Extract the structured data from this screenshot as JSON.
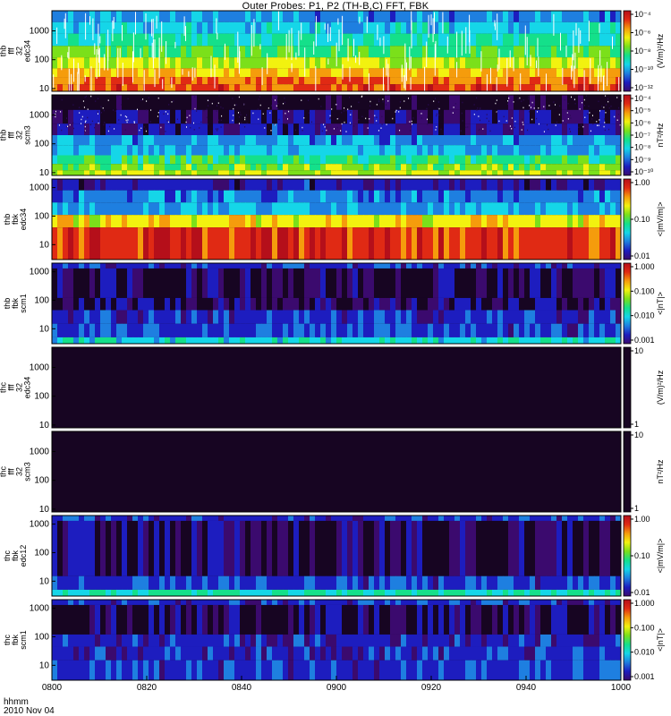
{
  "title": "Outer Probes: P1, P2 (TH-B,C) FFT, FBK",
  "footer": {
    "hhmm": "hhmm",
    "date": "2010 Nov 04"
  },
  "colors": {
    "colorbar": [
      "#3b0a6e",
      "#1d1dbf",
      "#1e7fe0",
      "#15d6e8",
      "#14e08a",
      "#7be01a",
      "#f2f20f",
      "#f59c0c",
      "#e02a14",
      "#b50f1a"
    ],
    "background_dark": "#170522"
  },
  "chart_data": [
    {
      "type": "heatmap",
      "probe": "thb",
      "kind": "fff",
      "channel": "32",
      "quantity": "edc34",
      "ylabel": [
        "thb",
        "fff",
        "32",
        "edc34"
      ],
      "yscale": "log",
      "ylim": [
        8,
        5000
      ],
      "yticks": [
        "1000",
        "100",
        "10"
      ],
      "cbar_units": "(V/m)²/Hz",
      "cbar_ticks": [
        "10⁻⁴",
        "10⁻⁶",
        "10⁻⁸",
        "10⁻¹⁰",
        "10⁻¹²"
      ],
      "bands": [
        {
          "lo": 5000,
          "hi": 2000,
          "level": 0.24
        },
        {
          "lo": 2000,
          "hi": 800,
          "level": 0.32
        },
        {
          "lo": 800,
          "hi": 300,
          "level": 0.4
        },
        {
          "lo": 300,
          "hi": 120,
          "level": 0.5
        },
        {
          "lo": 120,
          "hi": 50,
          "level": 0.62
        },
        {
          "lo": 50,
          "hi": 25,
          "level": 0.74
        },
        {
          "lo": 25,
          "hi": 14,
          "level": 0.82
        },
        {
          "lo": 14,
          "hi": 8,
          "level": 0.88
        }
      ]
    },
    {
      "type": "heatmap",
      "probe": "thb",
      "kind": "fff",
      "channel": "32",
      "quantity": "scm3",
      "ylabel": [
        "thb",
        "fff",
        "32",
        "scm3"
      ],
      "yscale": "log",
      "ylim": [
        8,
        5000
      ],
      "yticks": [
        "1000",
        "100",
        "10"
      ],
      "cbar_units": "nT²/Hz",
      "cbar_ticks": [
        "10⁻⁴",
        "10⁻⁵",
        "10⁻⁶",
        "10⁻⁷",
        "10⁻⁸",
        "10⁻⁹",
        "10⁻¹⁰"
      ],
      "bands": [
        {
          "lo": 5000,
          "hi": 1500,
          "level": -1
        },
        {
          "lo": 1500,
          "hi": 500,
          "level": 0.03
        },
        {
          "lo": 500,
          "hi": 200,
          "level": 0.08
        },
        {
          "lo": 200,
          "hi": 90,
          "level": 0.24
        },
        {
          "lo": 90,
          "hi": 40,
          "level": 0.3
        },
        {
          "lo": 40,
          "hi": 20,
          "level": 0.45
        },
        {
          "lo": 20,
          "hi": 12,
          "level": 0.55
        },
        {
          "lo": 12,
          "hi": 8,
          "level": 0.62
        }
      ]
    },
    {
      "type": "heatmap",
      "probe": "thb",
      "kind": "fbk",
      "quantity": "edc34",
      "ylabel": [
        "thb",
        "fbk",
        "edc34"
      ],
      "yscale": "log",
      "ylim": [
        3,
        2000
      ],
      "yticks": [
        "1000",
        "100",
        "10"
      ],
      "cbar_units": "<|mV/m|>",
      "cbar_ticks": [
        "1.00",
        "0.10",
        "0.01"
      ],
      "bands": [
        {
          "lo": 2000,
          "hi": 800,
          "level": 0.08
        },
        {
          "lo": 800,
          "hi": 300,
          "level": 0.22
        },
        {
          "lo": 300,
          "hi": 110,
          "level": 0.28
        },
        {
          "lo": 110,
          "hi": 40,
          "level": 0.68
        },
        {
          "lo": 40,
          "hi": 3,
          "level": 0.9
        }
      ]
    },
    {
      "type": "heatmap",
      "probe": "thb",
      "kind": "fbk",
      "quantity": "scm1",
      "ylabel": [
        "thb",
        "fbk",
        "scm1"
      ],
      "yscale": "log",
      "ylim": [
        3,
        2000
      ],
      "yticks": [
        "1000",
        "100",
        "10"
      ],
      "cbar_units": "<|nT|>",
      "cbar_ticks": [
        "1.000",
        "0.100",
        "0.010",
        "0.001"
      ],
      "bands": [
        {
          "lo": 2000,
          "hi": 1300,
          "level": 0.12
        },
        {
          "lo": 1300,
          "hi": 120,
          "level": 0.01
        },
        {
          "lo": 120,
          "hi": 45,
          "level": 0.03
        },
        {
          "lo": 45,
          "hi": 15,
          "level": 0.12
        },
        {
          "lo": 15,
          "hi": 5,
          "level": 0.14
        },
        {
          "lo": 5,
          "hi": 3,
          "level": 0.35
        }
      ]
    },
    {
      "type": "heatmap",
      "probe": "thc",
      "kind": "fff",
      "channel": "32",
      "quantity": "edc34",
      "ylabel": [
        "thc",
        "fff",
        "32",
        "edc34"
      ],
      "yscale": "log",
      "ylim": [
        8,
        5000
      ],
      "yticks": [
        "1000",
        "100",
        "10"
      ],
      "cbar_units": "(V/m)²/Hz",
      "cbar_ticks": [
        "10",
        "1"
      ],
      "bands": [
        {
          "lo": 5000,
          "hi": 8,
          "level": -1
        }
      ]
    },
    {
      "type": "heatmap",
      "probe": "thc",
      "kind": "fff",
      "channel": "32",
      "quantity": "scm3",
      "ylabel": [
        "thc",
        "fff",
        "32",
        "scm3"
      ],
      "yscale": "log",
      "ylim": [
        8,
        5000
      ],
      "yticks": [
        "1000",
        "100",
        "10"
      ],
      "cbar_units": "nT²/Hz",
      "cbar_ticks": [
        "10",
        "1"
      ],
      "bands": [
        {
          "lo": 5000,
          "hi": 8,
          "level": -1
        }
      ]
    },
    {
      "type": "heatmap",
      "probe": "thc",
      "kind": "fbk",
      "quantity": "edc12",
      "ylabel": [
        "thc",
        "fbk",
        "edc12"
      ],
      "yscale": "log",
      "ylim": [
        3,
        2000
      ],
      "yticks": [
        "1000",
        "100",
        "10"
      ],
      "cbar_units": "<|mV/m|>",
      "cbar_ticks": [
        "1.00",
        "0.10",
        "0.01"
      ],
      "bands": [
        {
          "lo": 2000,
          "hi": 1300,
          "level": 0.12
        },
        {
          "lo": 1300,
          "hi": 15,
          "level": 0.01
        },
        {
          "lo": 15,
          "hi": 5,
          "level": 0.14
        },
        {
          "lo": 5,
          "hi": 3,
          "level": 0.4
        }
      ]
    },
    {
      "type": "heatmap",
      "probe": "thc",
      "kind": "fbk",
      "quantity": "scm1",
      "ylabel": [
        "thc",
        "fbk",
        "scm1"
      ],
      "yscale": "log",
      "ylim": [
        3,
        2000
      ],
      "yticks": [
        "1000",
        "100",
        "10"
      ],
      "cbar_units": "<|nT|>",
      "cbar_ticks": [
        "1.000",
        "0.100",
        "0.010",
        "0.001"
      ],
      "bands": [
        {
          "lo": 2000,
          "hi": 1300,
          "level": 0.12
        },
        {
          "lo": 1300,
          "hi": 120,
          "level": 0.01
        },
        {
          "lo": 120,
          "hi": 45,
          "level": 0.1
        },
        {
          "lo": 45,
          "hi": 15,
          "level": 0.12
        },
        {
          "lo": 15,
          "hi": 3,
          "level": 0.14
        }
      ]
    }
  ],
  "x_axis": {
    "label": "hhmm",
    "ticks": [
      "0800",
      "0820",
      "0840",
      "0900",
      "0920",
      "0940",
      "1000"
    ],
    "range": [
      "0800",
      "1000"
    ]
  }
}
